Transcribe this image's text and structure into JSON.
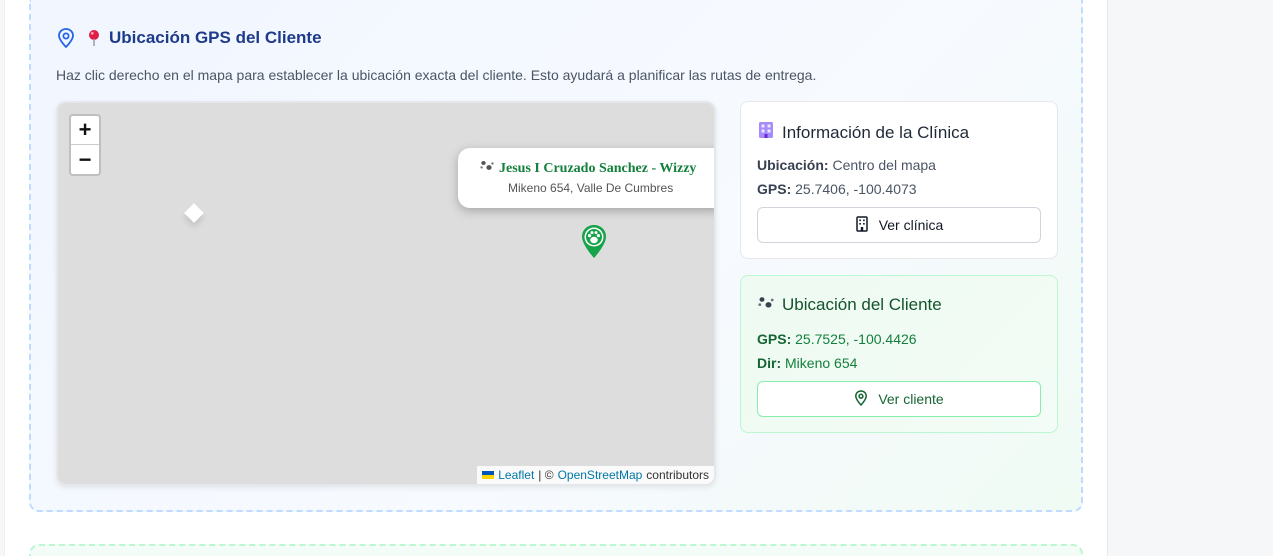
{
  "section": {
    "title": "Ubicación GPS del Cliente",
    "instructions": "Haz clic derecho en el mapa para establecer la ubicación exacta del cliente. Esto ayudará a planificar las rutas de entrega.",
    "icons": [
      "map-pin-outline-icon",
      "round-pushpin-emoji-icon"
    ],
    "accent_color": "#1e3a8a"
  },
  "map": {
    "zoom_in": "+",
    "zoom_out": "−",
    "popup": {
      "title": "Jesus I Cruzado Sanchez - Wizzy",
      "subtitle": "Mikeno 654, Valle De Cumbres"
    },
    "marker_icon": "paw-marker-icon",
    "marker_color": "#16a34a",
    "attribution": {
      "leaflet": "Leaflet",
      "separator": "| ©",
      "osm": "OpenStreetMap",
      "suffix": "contributors"
    }
  },
  "clinic": {
    "title": "Información de la Clínica",
    "location_label": "Ubicación:",
    "location_value": "Centro del mapa",
    "gps_label": "GPS:",
    "gps_value": "25.7406, -100.4073",
    "button_label": "Ver clínica",
    "icons": [
      "clinic-building-emoji-icon",
      "building-icon"
    ]
  },
  "client": {
    "title": "Ubicación del Cliente",
    "gps_label": "GPS:",
    "gps_value": "25.7525, -100.4426",
    "address_label": "Dir:",
    "address_value": "Mikeno 654",
    "button_label": "Ver cliente",
    "icons": [
      "paw-prints-icon",
      "map-pin-icon"
    ],
    "accent_color": "#166534"
  }
}
